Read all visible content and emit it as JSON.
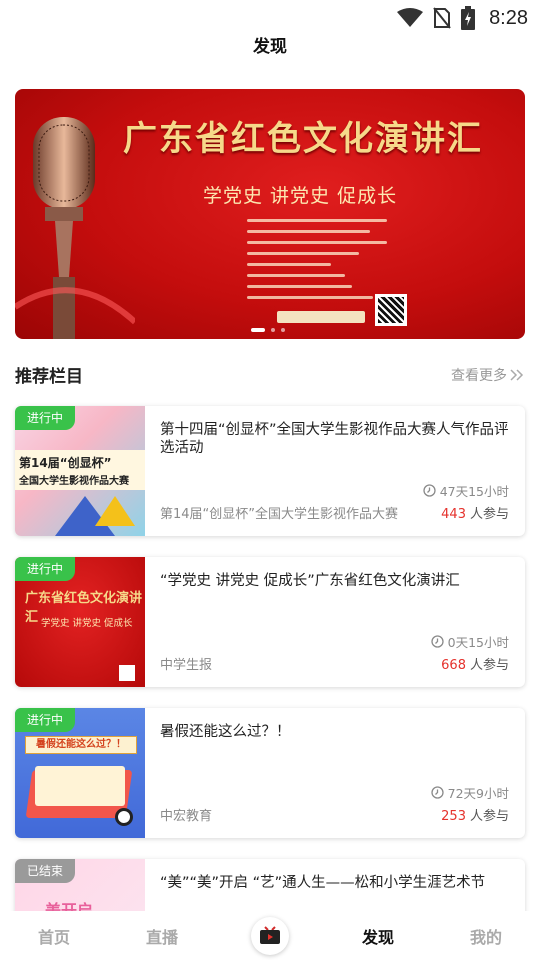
{
  "status": {
    "time": "8:28"
  },
  "header": {
    "title": "发现"
  },
  "banner": {
    "title": "广东省红色文化演讲汇",
    "subtitle": "学党史 讲党史 促成长",
    "dots": 3,
    "active_dot": 1
  },
  "section": {
    "title": "推荐栏目",
    "more_label": "查看更多"
  },
  "cards": [
    {
      "tag": "进行中",
      "title": "第十四届“创显杯”全国大学生影视作品大赛人气作品评选活动",
      "time": "47天15小时",
      "org": "第14届“创显杯”全国大学生影视作品大赛",
      "count": "443",
      "count_suffix": "人参与",
      "thumb_text1": "第14届“创显杯”",
      "thumb_text2": "全国大学生影视作品大赛"
    },
    {
      "tag": "进行中",
      "title": "“学党史 讲党史 促成长”广东省红色文化演讲汇",
      "time": "0天15小时",
      "org": "中学生报",
      "count": "668",
      "count_suffix": "人参与",
      "thumb_text1": "广东省红色文化演讲汇",
      "thumb_text2": "学党史 讲党史 促成长"
    },
    {
      "tag": "进行中",
      "title": "暑假还能这么过？！",
      "time": "72天9小时",
      "org": "中宏教育",
      "count": "253",
      "count_suffix": "人参与",
      "thumb_text1": "暑假还能这么过？！"
    },
    {
      "tag": "已结束",
      "title": "“美”“美”开启 “艺”通人生——松和小学生涯艺术节",
      "thumb_text1": "美开启"
    }
  ],
  "nav": {
    "home": "首页",
    "live": "直播",
    "discover": "发现",
    "mine": "我的"
  },
  "colors": {
    "accent_red": "#e5322d",
    "tag_green": "#39c24a",
    "tag_gray": "#9a9a9a"
  }
}
